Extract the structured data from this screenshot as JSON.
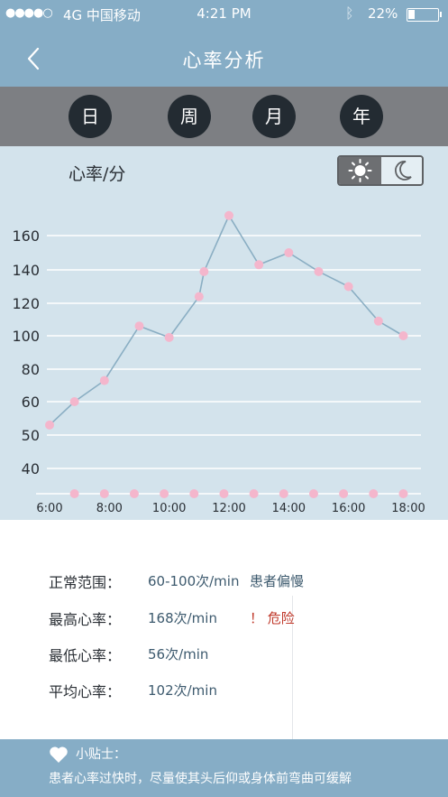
{
  "status_bar": {
    "signal": "●●●●○",
    "carrier": "4G 中国移动",
    "time": "4:21 PM",
    "battery_percent": "22%",
    "battery_level": 0.22
  },
  "nav": {
    "title": "心率分析"
  },
  "tabs": [
    {
      "label": "日",
      "active": true
    },
    {
      "label": "周",
      "active": false
    },
    {
      "label": "月",
      "active": false
    },
    {
      "label": "年",
      "active": false
    }
  ],
  "chart": {
    "title": "心率/分",
    "mode_icons": [
      "sun-icon",
      "moon-icon"
    ]
  },
  "chart_data": {
    "type": "line",
    "title": "心率/分",
    "xlabel": "",
    "ylabel": "",
    "x_ticks": [
      "6:00",
      "8:00",
      "10:00",
      "12:00",
      "14:00",
      "16:00",
      "18:00"
    ],
    "y_ticks": [
      40,
      50,
      60,
      80,
      100,
      120,
      140,
      160
    ],
    "grid": true,
    "line_color": "#8aaec3",
    "marker_color": "#f4b6cc",
    "series": [
      {
        "x": [
          "6:00",
          "6:50",
          "7:50",
          "9:00",
          "10:00",
          "11:00",
          "11:10",
          "12:00",
          "13:00",
          "14:00",
          "15:00",
          "16:00",
          "17:00",
          "17:50"
        ],
        "y": [
          53,
          60,
          73,
          106,
          99,
          124,
          139,
          172,
          143,
          150,
          139,
          130,
          109,
          100
        ]
      }
    ],
    "baseline_markers_x": [
      "6:50",
      "7:50",
      "8:50",
      "9:50",
      "10:50",
      "11:50",
      "12:50",
      "13:50",
      "14:50",
      "15:50",
      "16:50",
      "17:50"
    ]
  },
  "stats": {
    "normal_label": "正常范围：",
    "normal_value": "60-100次/min",
    "normal_note": "患者偏慢",
    "max_label": "最高心率：",
    "max_value": "168次/min",
    "max_warn": "！ 危险",
    "min_label": "最低心率：",
    "min_value": "56次/min",
    "avg_label": "平均心率：",
    "avg_value": "102次/min"
  },
  "tips": {
    "title": "小贴士：",
    "text": "患者心率过快时，尽量使其头后仰或身体前弯曲可缓解"
  },
  "colors": {
    "accent": "#86adc6",
    "tab_bar": "#7d7f83",
    "chart_bg": "#d3e3ec",
    "danger": "#c0392b"
  }
}
